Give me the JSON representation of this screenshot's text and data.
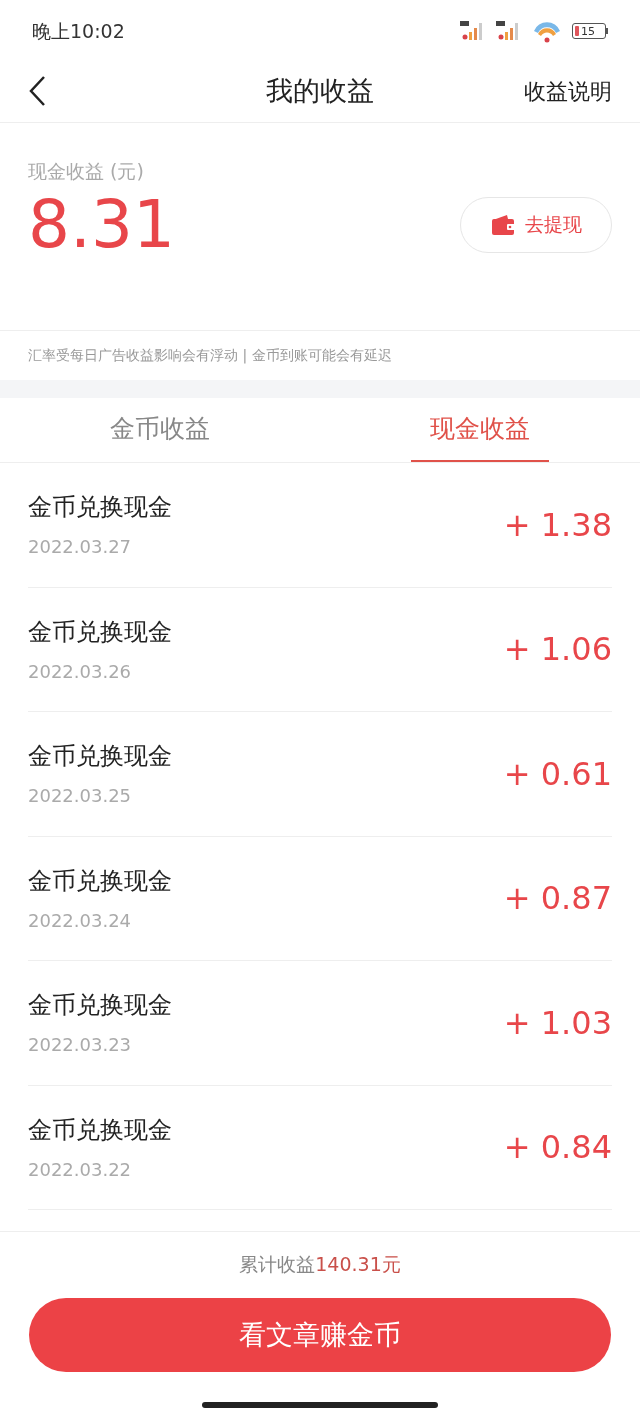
{
  "status_bar": {
    "time": "晚上10:02",
    "battery": "15"
  },
  "header": {
    "title": "我的收益",
    "action": "收益说明"
  },
  "balance": {
    "label": "现金收益 (元)",
    "amount": "8.31",
    "withdraw_button": "去提现"
  },
  "notice": "汇率受每日广告收益影响会有浮动 | 金币到账可能会有延迟",
  "tabs": [
    {
      "label": "金币收益",
      "selected": false
    },
    {
      "label": "现金收益",
      "selected": true
    }
  ],
  "records": [
    {
      "title": "金币兑换现金",
      "date": "2022.03.27",
      "amount": "+ 1.38"
    },
    {
      "title": "金币兑换现金",
      "date": "2022.03.26",
      "amount": "+ 1.06"
    },
    {
      "title": "金币兑换现金",
      "date": "2022.03.25",
      "amount": "+ 0.61"
    },
    {
      "title": "金币兑换现金",
      "date": "2022.03.24",
      "amount": "+ 0.87"
    },
    {
      "title": "金币兑换现金",
      "date": "2022.03.23",
      "amount": "+ 1.03"
    },
    {
      "title": "金币兑换现金",
      "date": "2022.03.22",
      "amount": "+ 0.84"
    }
  ],
  "footer": {
    "total_label": "累计收益",
    "total_amount": "140.31元",
    "button": "看文章赚金币"
  }
}
